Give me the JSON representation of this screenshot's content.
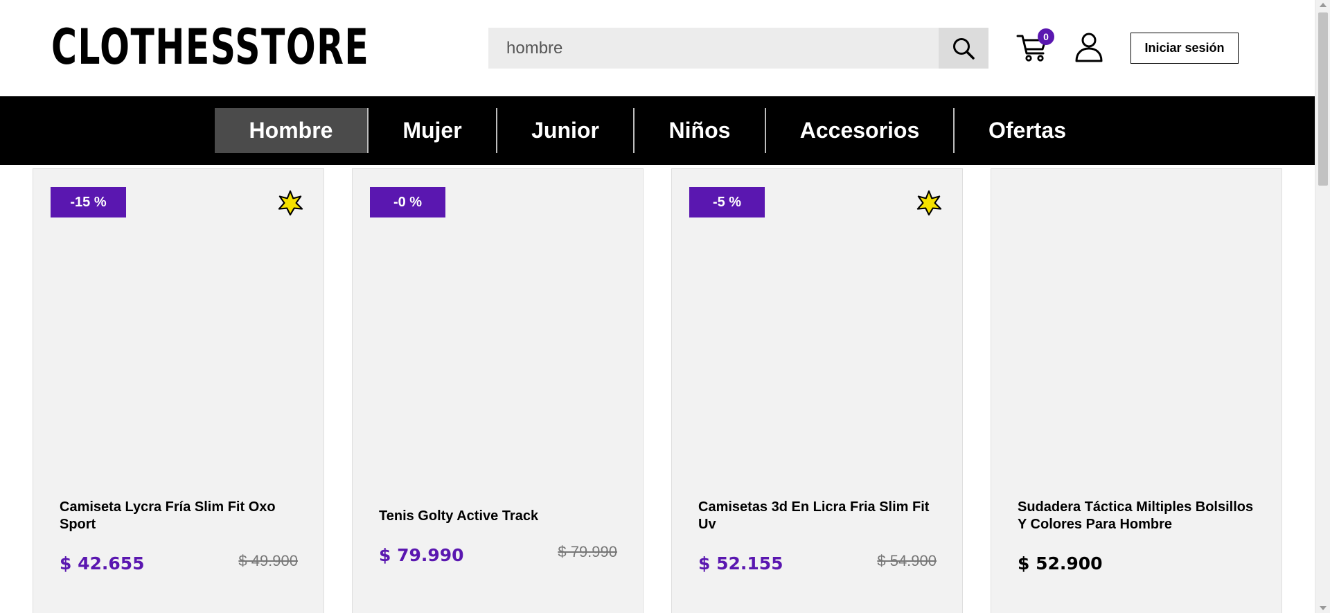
{
  "header": {
    "logo": "CLOTHESSTORE",
    "search_value": "hombre",
    "cart_count": "0",
    "login_label": "Iniciar sesión"
  },
  "nav": {
    "items": [
      {
        "label": "Hombre",
        "active": true
      },
      {
        "label": "Mujer"
      },
      {
        "label": "Junior"
      },
      {
        "label": "Niños"
      },
      {
        "label": "Accesorios"
      },
      {
        "label": "Ofertas"
      }
    ]
  },
  "products": [
    {
      "discount": "-15 %",
      "featured": true,
      "title": "Camiseta Lycra Fría Slim Fit Oxo Sport",
      "price": "$ 42.655",
      "old_price": "$ 49.900"
    },
    {
      "discount": "-0 %",
      "featured": false,
      "title": "Tenis Golty Active Track",
      "price": "$ 79.990",
      "old_price": "$ 79.990"
    },
    {
      "discount": "-5 %",
      "featured": true,
      "title": "Camisetas 3d En Licra Fria Slim Fit Uv",
      "price": "$ 52.155",
      "old_price": "$ 54.900"
    },
    {
      "title": "Sudadera Táctica Miltiples Bolsillos Y Colores Para Hombre",
      "price": "$ 52.900"
    }
  ],
  "colors": {
    "accent": "#5a17b0",
    "nav_bg": "#000000",
    "nav_active": "#4b4b4b",
    "card_bg": "#f2f2f2",
    "star": "#f5e100"
  },
  "icons": {
    "search": "search-icon",
    "cart": "cart-icon",
    "user": "user-icon",
    "featured": "star-icon"
  }
}
